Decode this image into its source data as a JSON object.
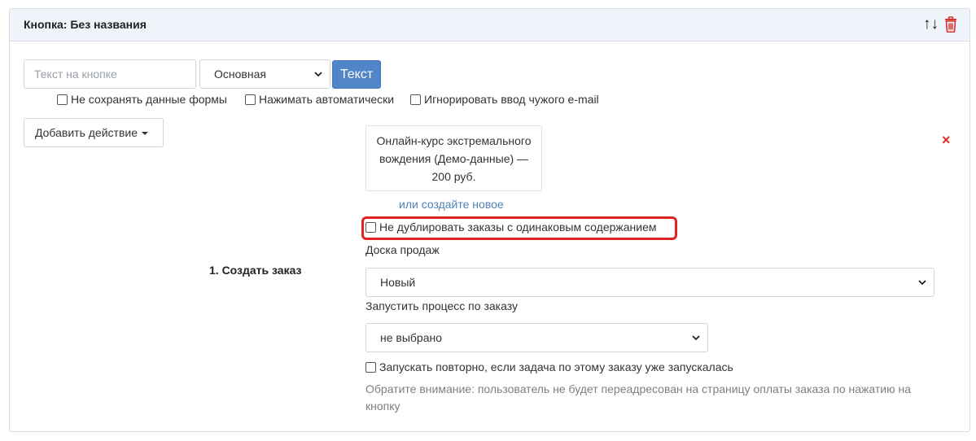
{
  "panel": {
    "title": "Кнопка: Без названия",
    "sort_icon": "↑↓",
    "delete_icon_name": "trash-icon"
  },
  "button_config": {
    "text_placeholder": "Текст на кнопке",
    "style_select_value": "Основная",
    "text_button_label": "Текст"
  },
  "form_options": {
    "no_save_label": "Не сохранять данные формы",
    "auto_press_label": "Нажимать автоматически",
    "ignore_email_label": "Игнорировать ввод чужого e-mail"
  },
  "add_action_label": "Добавить действие",
  "action": {
    "step_label": "1. Создать заказ",
    "product_text": "Онлайн-курс экстремального вождения (Демо-данные) — 200 руб.",
    "create_new_link": "или создайте новое",
    "no_duplicate_label": "Не дублировать заказы с одинаковым содержанием",
    "sales_board_label": "Доска продаж",
    "sales_board_value": "Новый",
    "process_label": "Запустить процесс по заказу",
    "process_value": "не выбрано",
    "rerun_label": "Запускать повторно, если задача по этому заказу уже запускалась",
    "note": "Обратите внимание: пользователь не будет переадресован на страницу оплаты заказа по нажатию на кнопку",
    "remove_icon": "×"
  },
  "colors": {
    "accent_blue": "#5086c8",
    "link_blue": "#4f82b8",
    "danger_red": "#d9312b",
    "highlight_red": "#e02424",
    "header_bg": "#eef4fa"
  }
}
